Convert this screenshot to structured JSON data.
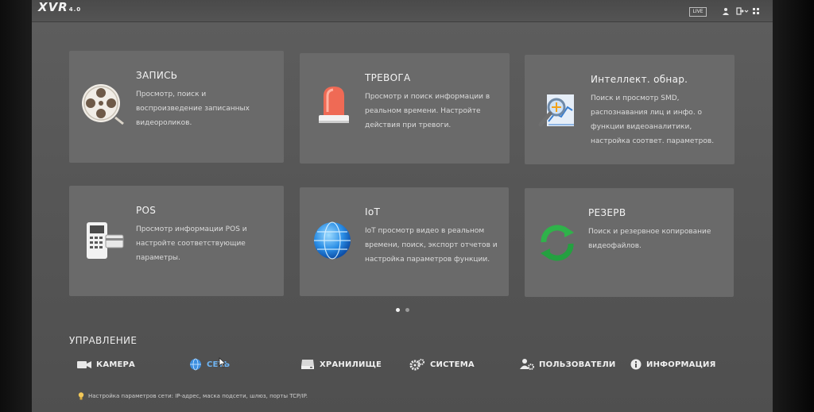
{
  "app": {
    "logo": "XVR",
    "logo_version": "4.0",
    "live_label": "LIVE"
  },
  "cards": [
    {
      "title": "ЗАПИСЬ",
      "icon": "film-reel-icon",
      "desc": [
        "Просмотр, поиск и",
        "воспроизведение записанных",
        "видеороликов."
      ]
    },
    {
      "title": "ТРЕВОГА",
      "icon": "alarm-beacon-icon",
      "desc": [
        "Просмотр и поиск информации в",
        "реальном времени. Настройте",
        "действия при тревоги."
      ]
    },
    {
      "title": "Интеллект. обнар.",
      "icon": "smart-detection-icon",
      "desc": [
        "Поиск и просмотр SMD,",
        "распознавания лиц и инфо. о",
        "функции видеоаналитики,",
        "настройка соответ. параметров."
      ]
    },
    {
      "title": "POS",
      "icon": "pos-terminal-icon",
      "desc": [
        "Просмотр информации POS и",
        "настройте соответствующие",
        "параметры."
      ]
    },
    {
      "title": "IoT",
      "icon": "globe-icon",
      "desc": [
        "IoT просмотр видео в реальном",
        "времени, поиск, экспорт отчетов и",
        "настройка параметров функции."
      ]
    },
    {
      "title": "РЕЗЕРВ",
      "icon": "backup-sync-icon",
      "desc": [
        "Поиск и резервное копирование",
        "видеофайлов."
      ]
    }
  ],
  "pager": {
    "count": 2,
    "active": 1
  },
  "management": {
    "title": "УПРАВЛЕНИЕ",
    "items": [
      {
        "label": "КАМЕРА",
        "icon": "camera-icon"
      },
      {
        "label": "СЕТЬ",
        "icon": "network-globe-icon"
      },
      {
        "label": "ХРАНИЛИЩЕ",
        "icon": "storage-icon"
      },
      {
        "label": "СИСТЕМА",
        "icon": "gears-icon"
      },
      {
        "label": "ПОЛЬЗОВАТЕЛИ",
        "icon": "users-gear-icon"
      },
      {
        "label": "ИНФОРМАЦИЯ",
        "icon": "info-icon"
      }
    ]
  },
  "hint": {
    "text": "Настройка параметров сети: IP-адрес, маска подсети, шлюз, порты TCP/IP.",
    "icon": "lightbulb-icon"
  },
  "colors": {
    "card": "#6a6a6a",
    "screen": "#585858",
    "accent_red": "#e8604c",
    "accent_green": "#2fb24a",
    "accent_blue": "#2e8fe0"
  }
}
